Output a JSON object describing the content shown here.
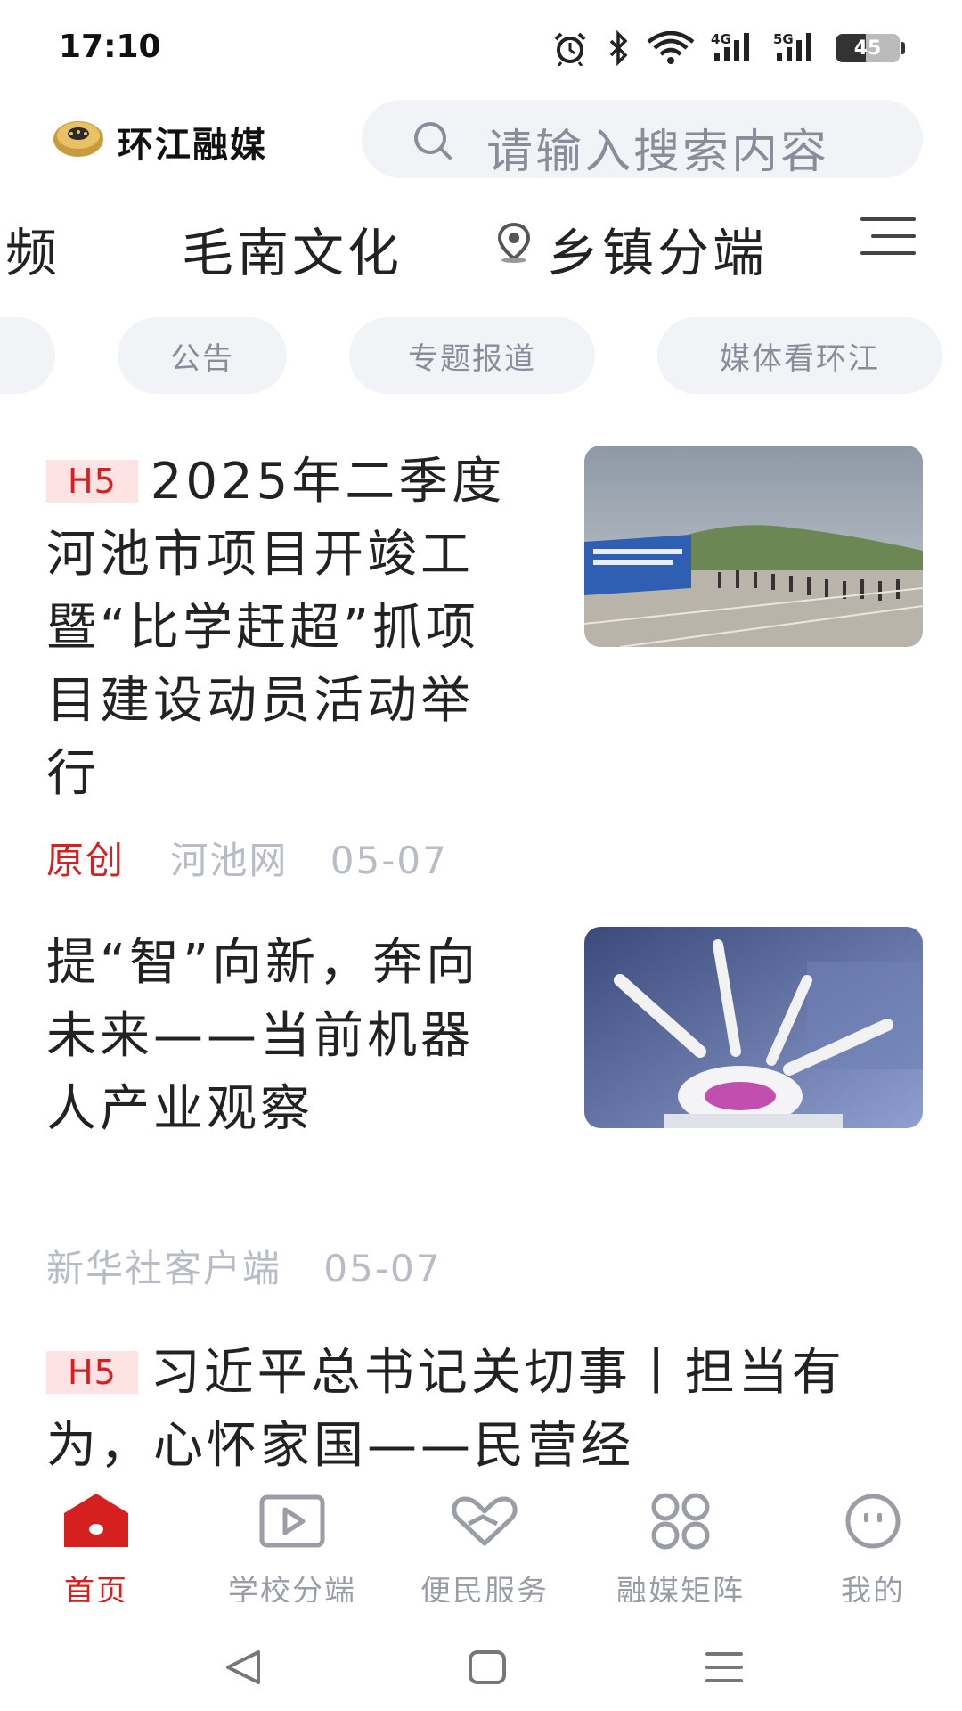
{
  "status_bar": {
    "time": "17:10",
    "icons": [
      "alarm-icon",
      "bluetooth-icon",
      "wifi-icon",
      "signal-4g-icon",
      "signal-5g-icon"
    ],
    "network_4g": "4G",
    "network_5g": "5G",
    "battery_level": "45"
  },
  "header": {
    "app_name": "环江融媒",
    "search_placeholder": "请输入搜索内容"
  },
  "channels": [
    "视频",
    "毛南文化",
    "乡镇分端"
  ],
  "tags": [
    "公告",
    "专题报道",
    "媒体看环江"
  ],
  "news": [
    {
      "badge": "H5",
      "title": "2025年二季度河池市项目开竣工暨“比学赶超”抓项目建设动员活动举行",
      "label": "原创",
      "source": "河池网",
      "date": "05-07",
      "image": "ceremony-photo"
    },
    {
      "badge": "",
      "title": "提“智”向新，奔向未来——当前机器人产业观察",
      "label": "",
      "source": "新华社客户端",
      "date": "05-07",
      "image": "surgical-robot-photo"
    },
    {
      "badge": "H5",
      "title": "习近平总书记关切事丨担当有为，心怀家国——民营经"
    }
  ],
  "bottom_nav": [
    {
      "label": "首页",
      "icon": "home-icon",
      "active": true
    },
    {
      "label": "学校分端",
      "icon": "video-play-icon",
      "active": false
    },
    {
      "label": "便民服务",
      "icon": "heart-hand-icon",
      "active": false
    },
    {
      "label": "融媒矩阵",
      "icon": "grid-icon",
      "active": false
    },
    {
      "label": "我的",
      "icon": "profile-face-icon",
      "active": false
    }
  ],
  "colors": {
    "accent": "#d61f1f",
    "badge_bg": "#fde3e3",
    "muted_text": "#b9bcc6",
    "pill_bg": "#f2f3f7"
  }
}
